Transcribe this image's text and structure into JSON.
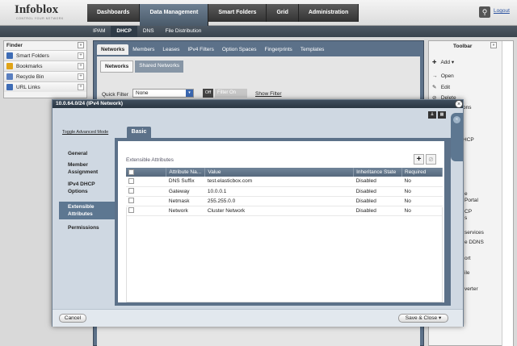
{
  "app": {
    "logo": "Infoblox",
    "logo_tagline": "CONTROL YOUR NETWORK",
    "logout": "Logout",
    "search_icon": "search-icon"
  },
  "main_tabs": [
    {
      "label": "Dashboards",
      "active": false
    },
    {
      "label": "Data Management",
      "active": true
    },
    {
      "label": "Smart Folders",
      "active": false
    },
    {
      "label": "Grid",
      "active": false
    },
    {
      "label": "Administration",
      "active": false
    }
  ],
  "sub_tabs": [
    {
      "label": "IPAM",
      "active": false
    },
    {
      "label": "DHCP",
      "active": true
    },
    {
      "label": "DNS",
      "active": false
    },
    {
      "label": "File Distribution",
      "active": false
    }
  ],
  "finder": {
    "title": "Finder",
    "items": [
      {
        "label": "Smart Folders",
        "icon": "folder-icon",
        "color": "#3e6cb5"
      },
      {
        "label": "Bookmarks",
        "icon": "star-icon",
        "color": "#e0a317"
      },
      {
        "label": "Recycle Bin",
        "icon": "recycle-bin-icon",
        "color": "#5a7fc0"
      },
      {
        "label": "URL Links",
        "icon": "link-icon",
        "color": "#3e6cb5"
      }
    ]
  },
  "networks_panel": {
    "tabs": [
      {
        "label": "Networks",
        "active": true
      },
      {
        "label": "Members",
        "active": false
      },
      {
        "label": "Leases",
        "active": false
      },
      {
        "label": "IPv4 Filters",
        "active": false
      },
      {
        "label": "Option Spaces",
        "active": false
      },
      {
        "label": "Fingerprints",
        "active": false
      },
      {
        "label": "Templates",
        "active": false
      }
    ],
    "subtabs": [
      {
        "label": "Networks",
        "active": true
      },
      {
        "label": "Shared Networks",
        "active": false
      }
    ],
    "quick_filter_label": "Quick Filter",
    "quick_filter_value": "None",
    "off_label": "Off",
    "filter_on_label": "Filter On",
    "show_filter": "Show Filter"
  },
  "toolbar": {
    "title": "Toolbar",
    "items": [
      {
        "label": "Add",
        "icon": "add-icon"
      },
      {
        "label": "Open",
        "icon": "open-icon"
      },
      {
        "label": "Edit",
        "icon": "edit-icon"
      },
      {
        "label": "Delete",
        "icon": "delete-icon"
      },
      {
        "label": "ons",
        "icon": ""
      },
      {
        "label": "HCP",
        "icon": ""
      },
      {
        "label": "e",
        "icon": ""
      },
      {
        "label": "Portal",
        "icon": ""
      },
      {
        "label": "CP",
        "icon": ""
      },
      {
        "label": "s",
        "icon": ""
      },
      {
        "label": "services",
        "icon": ""
      },
      {
        "label": "e DDNS",
        "icon": ""
      },
      {
        "label": "ort",
        "icon": ""
      },
      {
        "label": "ile",
        "icon": ""
      },
      {
        "label": "verter",
        "icon": ""
      }
    ]
  },
  "dialog": {
    "title": "10.0.64.0/24 (IPv4 Network)",
    "toggle_advanced": "Toggle Advanced Mode",
    "nav": [
      {
        "label": "General",
        "active": false
      },
      {
        "label": "Member Assignment",
        "active": false
      },
      {
        "label": "IPv4 DHCP Options",
        "active": false
      },
      {
        "label": "Extensible Attributes",
        "active": true
      },
      {
        "label": "Permissions",
        "active": false
      }
    ],
    "tab": "Basic",
    "section_title": "Extensible Attributes",
    "columns": [
      "Attribute Na...",
      "Value",
      "Inheritance State",
      "Required"
    ],
    "rows": [
      {
        "attribute": "DNS Suffix",
        "value": "test.elasticbox.com",
        "inheritance": "Disabled",
        "required": "No"
      },
      {
        "attribute": "Gateway",
        "value": "10.0.0.1",
        "inheritance": "Disabled",
        "required": "No"
      },
      {
        "attribute": "Netmask",
        "value": "255.255.0.0",
        "inheritance": "Disabled",
        "required": "No"
      },
      {
        "attribute": "Network",
        "value": "Cluster Network",
        "inheritance": "Disabled",
        "required": "No"
      }
    ],
    "cancel": "Cancel",
    "save_close": "Save & Close"
  }
}
